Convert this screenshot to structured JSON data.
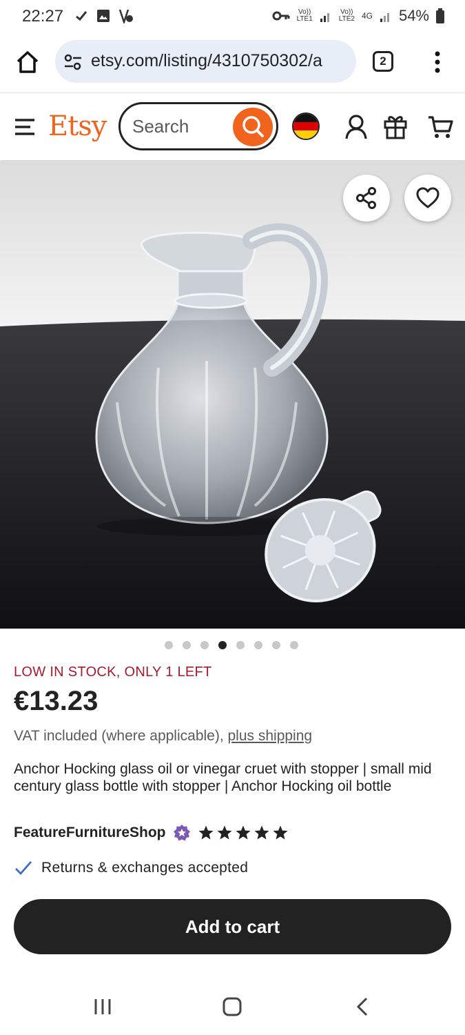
{
  "status_bar": {
    "time": "22:27",
    "battery": "54%",
    "sim1_label": "Vo))",
    "sim1_sub": "LTE1",
    "sim2_label": "Vo))",
    "sim2_sub": "LTE2",
    "network": "4G",
    "icons": [
      "check-icon",
      "image-icon",
      "vpn-icon",
      "key-icon",
      "signal-icon",
      "battery-icon"
    ]
  },
  "browser": {
    "url": "etsy.com/listing/4310750302/a",
    "tab_count": "2"
  },
  "header": {
    "logo": "Etsy",
    "search_placeholder": "Search",
    "colors": {
      "brand": "#f1641e"
    }
  },
  "product": {
    "image_count": 8,
    "active_image": 4,
    "stock_notice": "LOW IN STOCK, ONLY 1 LEFT",
    "price": "€13.23",
    "vat_text": "VAT included (where applicable), ",
    "shipping_link": "plus shipping",
    "title": "Anchor Hocking glass oil or vinegar cruet with stopper | small mid century glass bottle with stopper | Anchor Hocking oil bottle",
    "shop_name": "FeatureFurnitureShop",
    "rating_stars": 5,
    "returns": "Returns & exchanges accepted",
    "add_to_cart": "Add to cart"
  }
}
